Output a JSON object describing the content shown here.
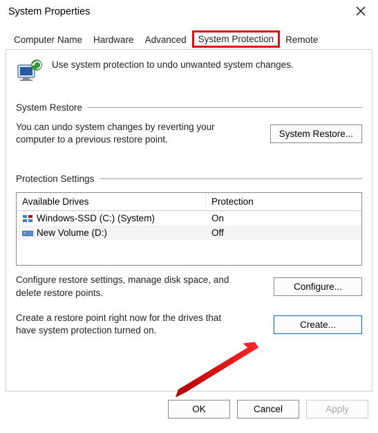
{
  "window": {
    "title": "System Properties"
  },
  "tabs": {
    "items": [
      {
        "label": "Computer Name"
      },
      {
        "label": "Hardware"
      },
      {
        "label": "Advanced"
      },
      {
        "label": "System Protection"
      },
      {
        "label": "Remote"
      }
    ]
  },
  "intro": {
    "text": "Use system protection to undo unwanted system changes."
  },
  "restore_section": {
    "title": "System Restore",
    "desc": "You can undo system changes by reverting your computer to a previous restore point.",
    "button": "System Restore..."
  },
  "protection_section": {
    "title": "Protection Settings",
    "columns": {
      "drives": "Available Drives",
      "protection": "Protection"
    },
    "drives": [
      {
        "name": "Windows-SSD (C:) (System)",
        "protection": "On",
        "icon": "drive-c"
      },
      {
        "name": "New Volume (D:)",
        "protection": "Off",
        "icon": "drive-d"
      }
    ],
    "configure": {
      "desc": "Configure restore settings, manage disk space, and delete restore points.",
      "button": "Configure..."
    },
    "create": {
      "desc": "Create a restore point right now for the drives that have system protection turned on.",
      "button": "Create..."
    }
  },
  "buttons": {
    "ok": "OK",
    "cancel": "Cancel",
    "apply": "Apply"
  }
}
